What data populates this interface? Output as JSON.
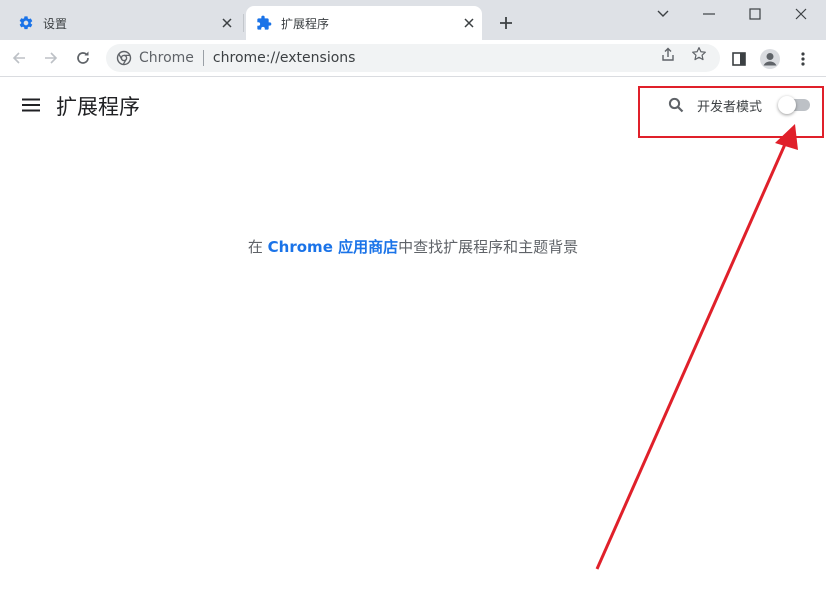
{
  "tabs": [
    {
      "title": "设置",
      "icon": "gear-icon",
      "active": false
    },
    {
      "title": "扩展程序",
      "icon": "puzzle-icon",
      "active": true
    }
  ],
  "window_controls": [
    "minimize",
    "restore",
    "close"
  ],
  "omnibox": {
    "origin": "Chrome",
    "url": "chrome://extensions"
  },
  "page": {
    "title": "扩展程序",
    "developer_mode_label": "开发者模式",
    "developer_mode_on": false,
    "empty_prefix": "在 ",
    "empty_link": "Chrome 应用商店",
    "empty_suffix": "中查找扩展程序和主题背景"
  },
  "colors": {
    "annotation": "#e0202a",
    "link": "#1a73e8",
    "accent": "#1a73e8"
  }
}
